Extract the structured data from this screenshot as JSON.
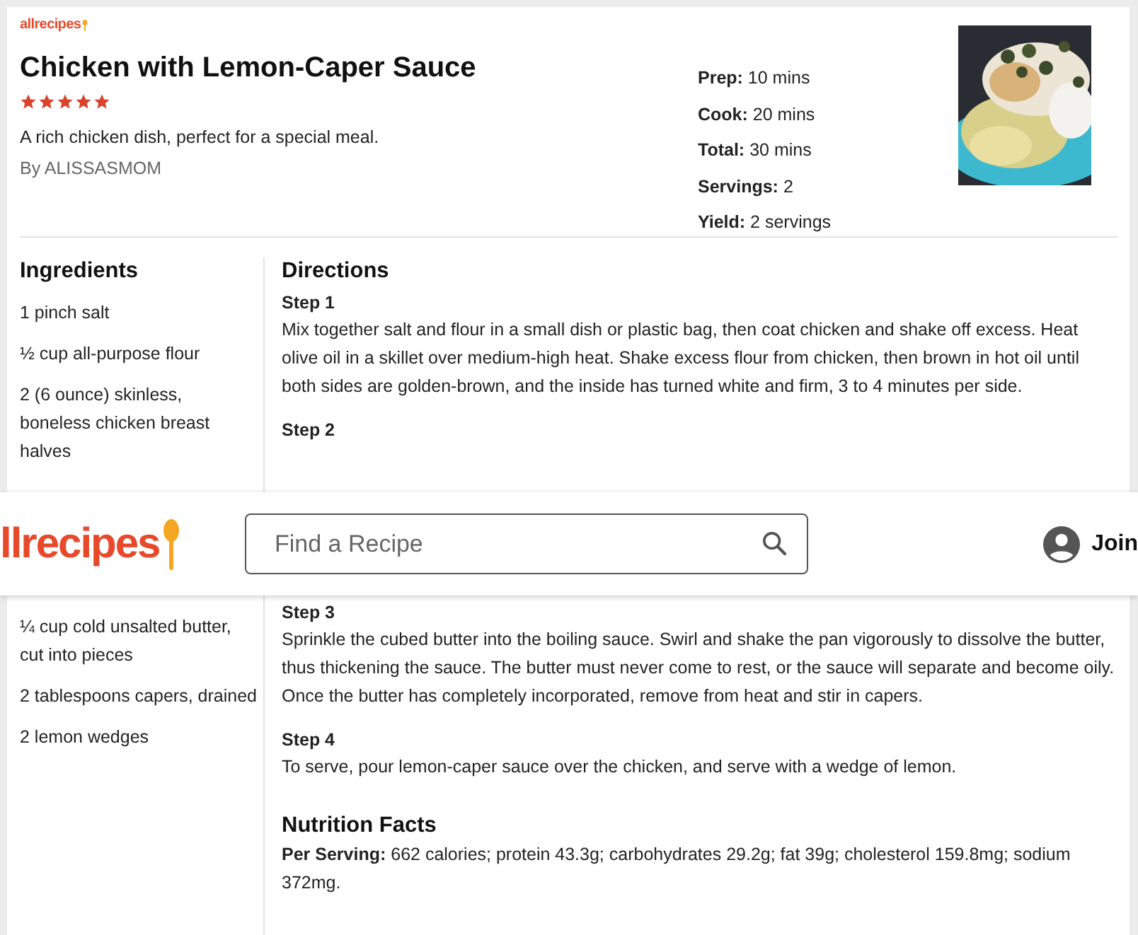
{
  "recipe": {
    "brand": "allrecipes",
    "title": "Chicken with Lemon-Caper Sauce",
    "stars": 5,
    "description": "A rich chicken dish, perfect for a special meal.",
    "author": "By ALISSASMOM",
    "facts": [
      {
        "label": "Prep:",
        "value": "10 mins"
      },
      {
        "label": "Cook:",
        "value": "20 mins"
      },
      {
        "label": "Total:",
        "value": "30 mins"
      },
      {
        "label": "Servings:",
        "value": "2"
      },
      {
        "label": "Yield:",
        "value": "2 servings"
      }
    ]
  },
  "ingredients": {
    "title": "Ingredients",
    "items_above": [
      "1 pinch salt",
      "½ cup all-purpose flour",
      "2 (6 ounce) skinless, boneless chicken breast halves"
    ],
    "items_below": [
      "¼ cup cold unsalted butter, cut into pieces",
      "2 tablespoons capers, drained",
      "2 lemon wedges"
    ]
  },
  "directions": {
    "title": "Directions",
    "steps_above": [
      {
        "title": "Step 1",
        "text": "Mix together salt and flour in a small dish or plastic bag, then coat chicken and shake off excess. Heat olive oil in a skillet over medium-high heat. Shake excess flour from chicken, then brown in hot oil until both sides are golden-brown, and the inside has turned white and firm, 3 to 4 minutes per side."
      },
      {
        "title": "Step 2"
      }
    ],
    "steps_below": [
      {
        "title": "Step 3",
        "text": "Sprinkle the cubed butter into the boiling sauce. Swirl and shake the pan vigorously to dissolve the butter, thus thickening the sauce. The butter must never come to rest, or the sauce will separate and become oily. Once the butter has completely incorporated, remove from heat and stir in capers."
      },
      {
        "title": "Step 4",
        "text": "To serve, pour lemon-caper sauce over the chicken, and serve with a wedge of lemon."
      }
    ]
  },
  "nutrition": {
    "title": "Nutrition Facts",
    "text": "**Per Serving:** 662 calories; protein 43.3g; carbohydrates 29.2g; fat 39g; cholesterol 159.8mg; sodium 372mg."
  },
  "header": {
    "logo": "llrecipes",
    "search": {
      "placeholder": "Find a Recipe"
    },
    "join": "Join"
  }
}
